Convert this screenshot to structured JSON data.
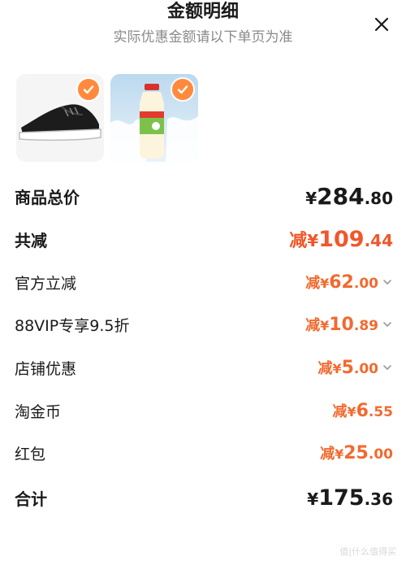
{
  "header": {
    "title": "金额明细",
    "subtitle": "实际优惠金额请以下单页为准",
    "close_icon": "close-icon"
  },
  "products": [
    {
      "name": "black-sneaker",
      "selected": true
    },
    {
      "name": "milk-drink-bottle",
      "selected": true
    }
  ],
  "rows": {
    "subtotal": {
      "label": "商品总价",
      "yen": "¥",
      "int": "284",
      "dec": ".80"
    },
    "total_discount": {
      "label": "共减",
      "prefix": "减",
      "yen": "¥",
      "int": "109",
      "dec": ".44"
    },
    "official": {
      "label": "官方立减",
      "prefix": "减",
      "yen": "¥",
      "int": "62",
      "dec": ".00"
    },
    "vip": {
      "label": "88VIP专享9.5折",
      "prefix": "减",
      "yen": "¥",
      "int": "10",
      "dec": ".89"
    },
    "store": {
      "label": "店铺优惠",
      "prefix": "减",
      "yen": "¥",
      "int": "5",
      "dec": ".00"
    },
    "taojinbi": {
      "label": "淘金币",
      "prefix": "减",
      "yen": "¥",
      "int": "6",
      "dec": ".55"
    },
    "hongbao": {
      "label": "红包",
      "prefix": "减",
      "yen": "¥",
      "int": "25",
      "dec": ".00"
    },
    "total": {
      "label": "合计",
      "yen": "¥",
      "int": "175",
      "dec": ".36"
    }
  },
  "watermark": "值|什么值得买",
  "colors": {
    "accent": "#f2562a",
    "check": "#ff8a3d"
  }
}
